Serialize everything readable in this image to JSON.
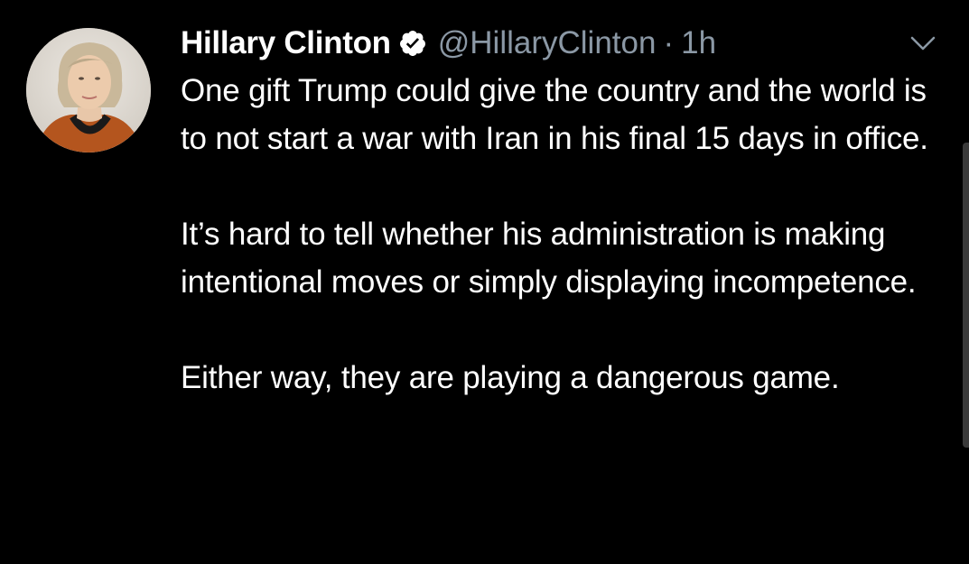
{
  "tweet": {
    "author": {
      "display_name": "Hillary Clinton",
      "verified": true,
      "handle": "@HillaryClinton",
      "separator": "·",
      "time": "1h"
    },
    "avatar_icon": "profile-photo",
    "menu_icon": "chevron-down-icon",
    "paragraphs": [
      "One gift Trump could give the country and the world is to not start a war with Iran in his final 15 days in office.",
      "It’s hard to tell whether his administration is making intentional moves or simply displaying incompetence.",
      "Either way, they are playing a dangerous game."
    ]
  },
  "colors": {
    "background": "#000000",
    "text": "#ffffff",
    "secondary_text": "#8b98a5",
    "verified_badge": "#ffffff"
  }
}
